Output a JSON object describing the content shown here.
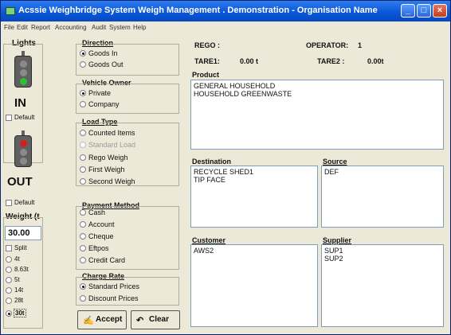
{
  "window": {
    "title": "Acssie Weighbridge System Weigh Management . Demonstration - Organisation Name",
    "min_icon": "minimize-icon",
    "max_icon": "maximize-icon",
    "close_icon": "close-icon"
  },
  "menu": [
    "File",
    "Edit",
    "Report",
    "Accounting",
    "Audit",
    "System",
    "Help"
  ],
  "lights": {
    "title": "Lights",
    "in_label": "IN",
    "out_label": "OUT",
    "default_label": "Default",
    "default_label_2": "Default"
  },
  "weight": {
    "label": "Weight (t",
    "value": "30.00",
    "split_label": "Split",
    "options": [
      "4t",
      "8.63t",
      "5t",
      "14t",
      "28t",
      "30t"
    ],
    "selected_option": "30t"
  },
  "direction": {
    "title": "Direction",
    "options": [
      "Goods In",
      "Goods Out"
    ],
    "selected": "Goods In"
  },
  "vehicle_owner": {
    "title": "Vehicle Owner",
    "options": [
      "Private",
      "Company"
    ],
    "selected": "Private"
  },
  "load_type": {
    "title": "Load Type",
    "options": [
      "Counted Items",
      "Standard Load",
      "Rego Weigh",
      "First Weigh",
      "Second Weigh"
    ],
    "disabled": [
      "Standard Load"
    ]
  },
  "payment_method": {
    "title": "Payment Method",
    "options": [
      "Cash",
      "Account",
      "Cheque",
      "Eftpos",
      "Credit Card"
    ]
  },
  "charge_rate": {
    "title": "Charge Rate",
    "options": [
      "Standard Prices",
      "Discount Prices"
    ],
    "selected": "Standard Prices"
  },
  "buttons": {
    "accept": "Accept",
    "clear": "Clear",
    "accept_icon": "accept-icon",
    "clear_icon": "clear-icon"
  },
  "header_info": {
    "rego_label": "REGO :",
    "operator_label": "OPERATOR:",
    "operator_value": "1",
    "tare1_label": "TARE1:",
    "tare1_value": "0.00 t",
    "tare2_label": "TARE2 :",
    "tare2_value": "0.00t"
  },
  "product": {
    "title": "Product",
    "items": [
      "GENERAL HOUSEHOLD",
      "HOUSEHOLD GREENWASTE"
    ]
  },
  "destination": {
    "title": "Destination",
    "items": [
      "RECYCLE SHED1",
      "TIP FACE"
    ]
  },
  "source": {
    "title": "Source",
    "items": [
      "DEF"
    ]
  },
  "customer": {
    "title": "Customer",
    "items": [
      "AWS2"
    ]
  },
  "supplier": {
    "title": "Supplier",
    "items": [
      "SUP1",
      "SUP2"
    ]
  },
  "colors": {
    "titlebar": "#0a58d8",
    "window_bg": "#ece9d8",
    "light_green": "#2ec02e",
    "light_red": "#d22020",
    "light_off": "#8a8a8a"
  }
}
